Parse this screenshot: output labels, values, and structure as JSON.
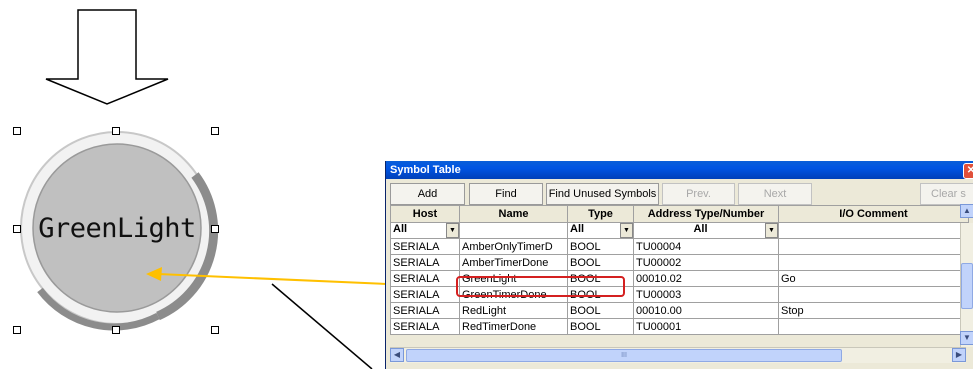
{
  "lamp": {
    "label": "GreenLight"
  },
  "window": {
    "title": "Symbol Table",
    "close_symbol": "✕"
  },
  "toolbar": {
    "add": "Add",
    "find": "Find",
    "find_unused": "Find Unused Symbols",
    "prev": "Prev.",
    "next": "Next",
    "clear": "Clear s"
  },
  "table": {
    "headers": [
      "Host",
      "Name",
      "Type",
      "Address Type/Number",
      "I/O Comment"
    ],
    "filters": [
      "All",
      "",
      "All",
      "All",
      ""
    ],
    "rows": [
      [
        "SERIALA",
        "AmberOnlyTimerD",
        "BOOL",
        "TU00004",
        ""
      ],
      [
        "SERIALA",
        "AmberTimerDone",
        "BOOL",
        "TU00002",
        ""
      ],
      [
        "SERIALA",
        "GreenLight",
        "BOOL",
        "00010.02",
        "Go"
      ],
      [
        "SERIALA",
        "GreenTimerDone",
        "BOOL",
        "TU00003",
        ""
      ],
      [
        "SERIALA",
        "RedLight",
        "BOOL",
        "00010.00",
        "Stop"
      ],
      [
        "SERIALA",
        "RedTimerDone",
        "BOOL",
        "TU00001",
        ""
      ]
    ]
  },
  "scrollbar": {
    "up": "▲",
    "down": "▼",
    "left": "◀",
    "right": "▶",
    "grip": "III"
  },
  "colors": {
    "arrow": "#ffc000",
    "highlight": "#d42020",
    "lamp_fill": "#c0c0c0",
    "titlebar": "#0054e3"
  }
}
